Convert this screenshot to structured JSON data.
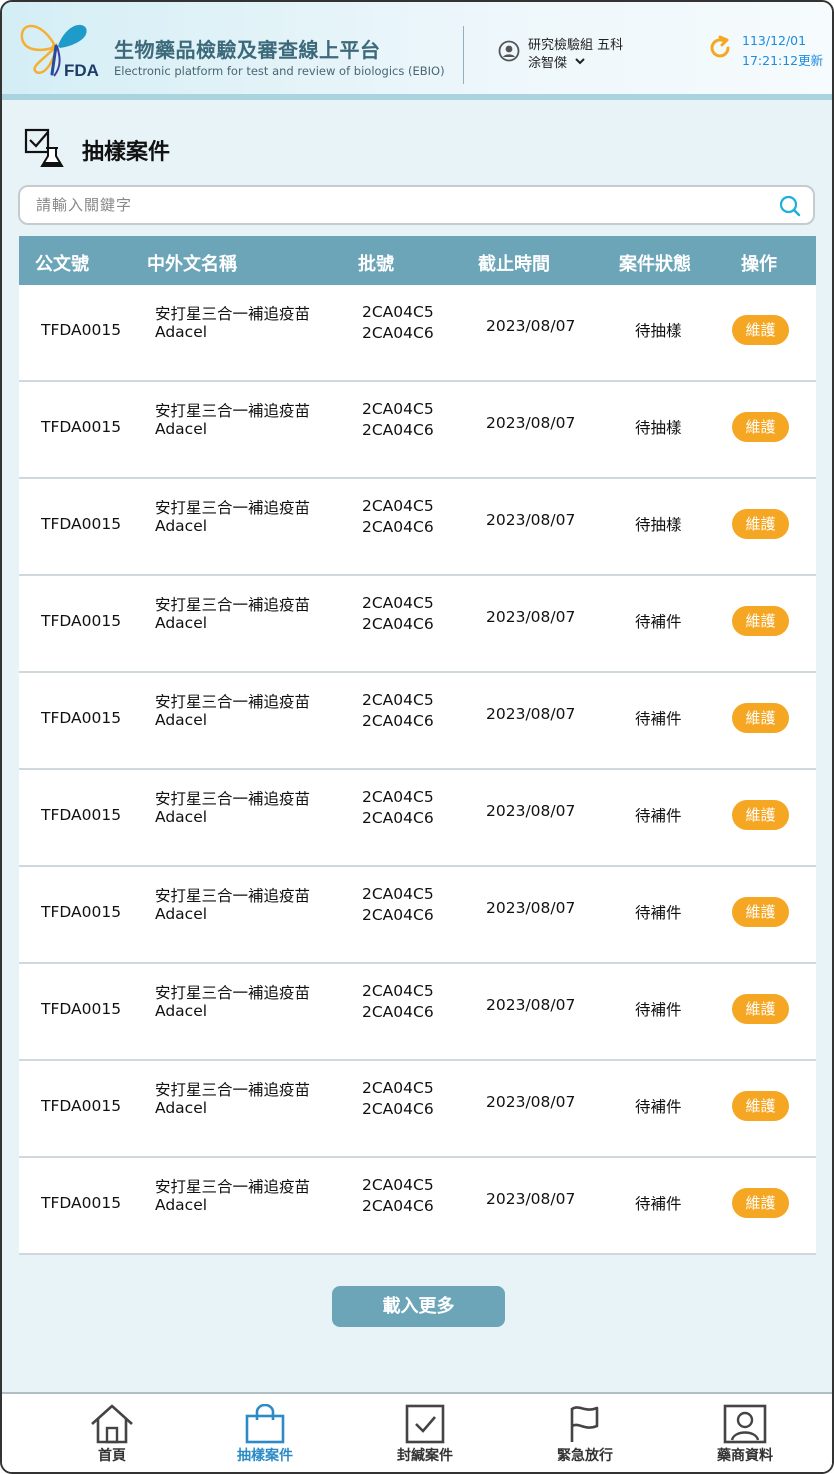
{
  "header": {
    "logo_text": "FDA",
    "title": "生物藥品檢驗及審查線上平台",
    "subtitle": "Electronic platform for test and review of biologics (EBIO)",
    "user_dept": "研究檢驗組 五科",
    "user_name": "涂智傑",
    "date": "113/12/01",
    "time_updated": "17:21:12更新"
  },
  "page": {
    "title": "抽樣案件"
  },
  "search": {
    "placeholder": "請輸入關鍵字"
  },
  "table": {
    "columns": [
      "公文號",
      "中外文名稱",
      "批號",
      "截止時間",
      "案件狀態",
      "操作"
    ],
    "rows": [
      {
        "doc_no": "TFDA0015",
        "name_zh": "安打星三合一補追疫苗",
        "name_en": "Adacel",
        "lot1": "2CA04C5",
        "lot2": "2CA04C6",
        "deadline": "2023/08/07",
        "status": "待抽樣",
        "action": "維護"
      },
      {
        "doc_no": "TFDA0015",
        "name_zh": "安打星三合一補追疫苗",
        "name_en": "Adacel",
        "lot1": "2CA04C5",
        "lot2": "2CA04C6",
        "deadline": "2023/08/07",
        "status": "待抽樣",
        "action": "維護"
      },
      {
        "doc_no": "TFDA0015",
        "name_zh": "安打星三合一補追疫苗",
        "name_en": "Adacel",
        "lot1": "2CA04C5",
        "lot2": "2CA04C6",
        "deadline": "2023/08/07",
        "status": "待抽樣",
        "action": "維護"
      },
      {
        "doc_no": "TFDA0015",
        "name_zh": "安打星三合一補追疫苗",
        "name_en": "Adacel",
        "lot1": "2CA04C5",
        "lot2": "2CA04C6",
        "deadline": "2023/08/07",
        "status": "待補件",
        "action": "維護"
      },
      {
        "doc_no": "TFDA0015",
        "name_zh": "安打星三合一補追疫苗",
        "name_en": "Adacel",
        "lot1": "2CA04C5",
        "lot2": "2CA04C6",
        "deadline": "2023/08/07",
        "status": "待補件",
        "action": "維護"
      },
      {
        "doc_no": "TFDA0015",
        "name_zh": "安打星三合一補追疫苗",
        "name_en": "Adacel",
        "lot1": "2CA04C5",
        "lot2": "2CA04C6",
        "deadline": "2023/08/07",
        "status": "待補件",
        "action": "維護"
      },
      {
        "doc_no": "TFDA0015",
        "name_zh": "安打星三合一補追疫苗",
        "name_en": "Adacel",
        "lot1": "2CA04C5",
        "lot2": "2CA04C6",
        "deadline": "2023/08/07",
        "status": "待補件",
        "action": "維護"
      },
      {
        "doc_no": "TFDA0015",
        "name_zh": "安打星三合一補追疫苗",
        "name_en": "Adacel",
        "lot1": "2CA04C5",
        "lot2": "2CA04C6",
        "deadline": "2023/08/07",
        "status": "待補件",
        "action": "維護"
      },
      {
        "doc_no": "TFDA0015",
        "name_zh": "安打星三合一補追疫苗",
        "name_en": "Adacel",
        "lot1": "2CA04C5",
        "lot2": "2CA04C6",
        "deadline": "2023/08/07",
        "status": "待補件",
        "action": "維護"
      },
      {
        "doc_no": "TFDA0015",
        "name_zh": "安打星三合一補追疫苗",
        "name_en": "Adacel",
        "lot1": "2CA04C5",
        "lot2": "2CA04C6",
        "deadline": "2023/08/07",
        "status": "待補件",
        "action": "維護"
      }
    ]
  },
  "load_more_label": "載入更多",
  "bottom_nav": {
    "items": [
      {
        "label": "首頁",
        "icon": "home-icon"
      },
      {
        "label": "抽樣案件",
        "icon": "bag-icon"
      },
      {
        "label": "封緘案件",
        "icon": "checkbox-icon"
      },
      {
        "label": "緊急放行",
        "icon": "flag-icon"
      },
      {
        "label": "藥商資料",
        "icon": "contact-card-icon"
      }
    ],
    "active_index": 1
  },
  "colors": {
    "accent": "#6ca5b8",
    "action_button": "#f5a623",
    "active_nav": "#2c8bc5",
    "refresh": "#f5a623",
    "timestamp": "#1d8be0"
  }
}
